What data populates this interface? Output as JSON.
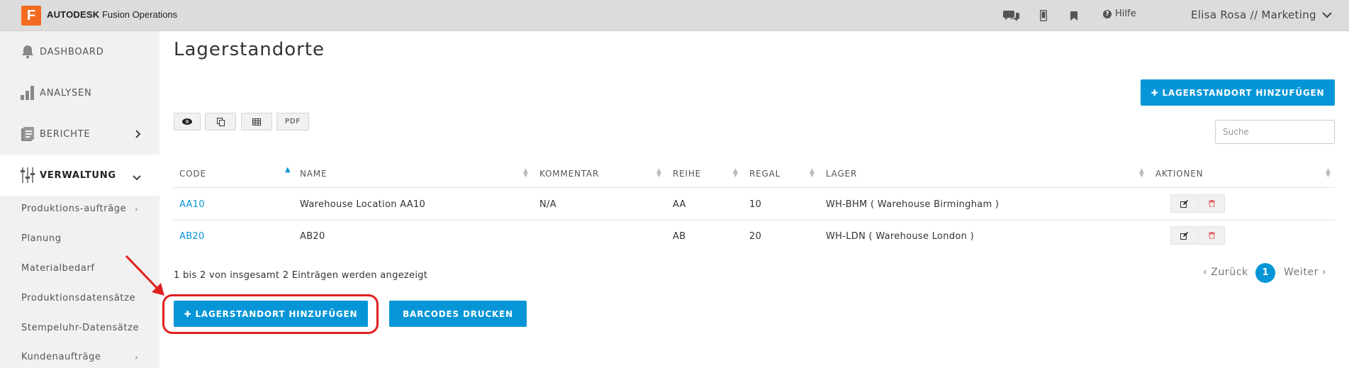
{
  "topbar": {
    "logo_letter": "F",
    "brand_bold": "AUTODESK",
    "brand_rest": "Fusion Operations",
    "help_label": "Hilfe",
    "user_label": "Elisa Rosa // Marketing"
  },
  "sidebar": {
    "items": [
      {
        "label": "DASHBOARD"
      },
      {
        "label": "ANALYSEN"
      },
      {
        "label": "BERICHTE"
      },
      {
        "label": "VERWALTUNG"
      }
    ],
    "subitems": [
      {
        "label": "Produktions-aufträge"
      },
      {
        "label": "Planung"
      },
      {
        "label": "Materialbedarf"
      },
      {
        "label": "Produktionsdatensätze"
      },
      {
        "label": "Stempeluhr-Datensätze"
      },
      {
        "label": "Kundenaufträge"
      }
    ]
  },
  "main": {
    "title": "Lagerstandorte",
    "add_button_top": "LAGERSTANDORT HINZUFÜGEN",
    "toolbar": {
      "pdf_label": "PDF"
    },
    "search_placeholder": "Suche",
    "columns": [
      "CODE",
      "NAME",
      "KOMMENTAR",
      "REIHE",
      "REGAL",
      "LAGER",
      "AKTIONEN"
    ],
    "rows": [
      {
        "code": "AA10",
        "name": "Warehouse Location AA10",
        "comment": "N/A",
        "row": "AA",
        "shelf": "10",
        "warehouse": "WH-BHM ( Warehouse Birmingham )"
      },
      {
        "code": "AB20",
        "name": "AB20",
        "comment": "",
        "row": "AB",
        "shelf": "20",
        "warehouse": "WH-LDN ( Warehouse London )"
      }
    ],
    "info_text": "1 bis 2 von insgesamt 2 Einträgen werden angezeigt",
    "pager": {
      "prev": "Zurück",
      "current": "1",
      "next": "Weiter"
    },
    "add_button_bottom": "LAGERSTANDORT HINZUFÜGEN",
    "barcodes_button": "BARCODES DRUCKEN"
  },
  "colors": {
    "accent": "#0696d7",
    "logo": "#f26b21",
    "annotation": "#e02020"
  }
}
